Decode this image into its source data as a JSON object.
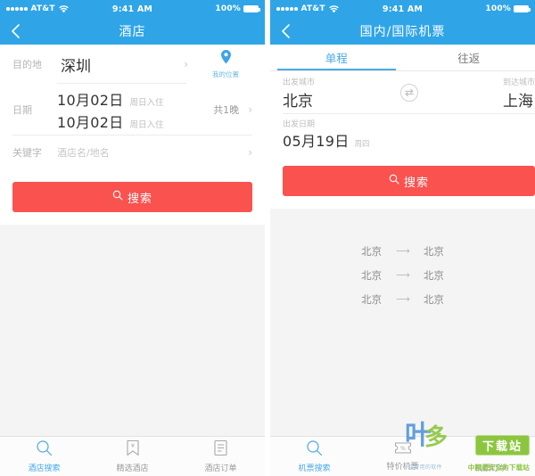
{
  "statusbar": {
    "carrier": "AT&T",
    "time": "9:41 AM",
    "battery": "100%",
    "wifi_icon": "wifi-icon",
    "signal_icon": "signal-dots-icon",
    "battery_icon": "battery-full-icon"
  },
  "colors": {
    "header_blue": "#2fa5e8",
    "accent_blue": "#49a9e8",
    "search_red": "#f9524f",
    "watermark_green": "#8cc63f"
  },
  "hotel": {
    "nav": {
      "title": "酒店",
      "back_icon": "back-chevron-icon"
    },
    "destination": {
      "label": "目的地",
      "value": "深圳",
      "chevron": "›",
      "my_location_label": "我的位置",
      "pin_icon": "location-pin-icon"
    },
    "date": {
      "label": "日期",
      "checkin_date": "10月02日",
      "checkin_day": "周日入住",
      "checkout_date": "10月02日",
      "checkout_day": "周日入住",
      "nights": "共1晚",
      "chevron": "›"
    },
    "keyword": {
      "label": "关键字",
      "placeholder": "酒店名/地名",
      "chevron": "›"
    },
    "search_button": {
      "label": "搜索",
      "icon": "search-icon"
    },
    "tabbar": [
      {
        "label": "酒店搜索",
        "icon": "search-icon",
        "active": true
      },
      {
        "label": "精选酒店",
        "icon": "bookmark-icon",
        "active": false
      },
      {
        "label": "酒店订单",
        "icon": "order-list-icon",
        "active": false
      }
    ]
  },
  "flight": {
    "nav": {
      "title": "国内/国际机票",
      "back_icon": "back-chevron-icon"
    },
    "tabs": [
      {
        "label": "单程",
        "active": true
      },
      {
        "label": "往返",
        "active": false
      }
    ],
    "from_city": {
      "label": "出发城市",
      "value": "北京"
    },
    "to_city": {
      "label": "到达城市",
      "value": "上海"
    },
    "swap_icon": "swap-arrows-icon",
    "depart": {
      "label": "出发日期",
      "date": "05月19日",
      "weekday": "周四"
    },
    "search_button": {
      "label": "搜索",
      "icon": "search-icon"
    },
    "history": [
      {
        "from": "北京",
        "arrow": "⟶",
        "to": "北京"
      },
      {
        "from": "北京",
        "arrow": "⟶",
        "to": "北京"
      },
      {
        "from": "北京",
        "arrow": "⟶",
        "to": "北京"
      }
    ],
    "tabbar": [
      {
        "label": "机票搜索",
        "icon": "search-icon",
        "active": true
      },
      {
        "label": "特价机票",
        "icon": "ticket-icon",
        "active": false
      },
      {
        "label": "机票订单",
        "icon": "order-list-icon",
        "active": false
      }
    ]
  },
  "watermark": {
    "badge": "下载站",
    "subtitle": "中国最安全的下载站",
    "logo_left": "叶",
    "logo_right": "多",
    "tiny": "超好用的软件"
  }
}
